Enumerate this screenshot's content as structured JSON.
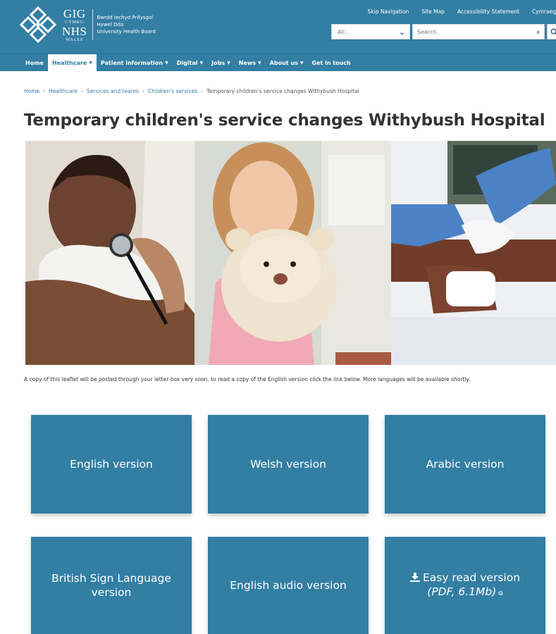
{
  "header": {
    "logo": {
      "line1": "GIG",
      "line2": "CYMRU",
      "line3": "NHS",
      "line4": "WALES"
    },
    "org_names": [
      "Bwrdd Iechyd Prifysgol",
      "Hywel Dda",
      "University Health Board"
    ],
    "utility_links": [
      "Skip Navigation",
      "Site Map",
      "Accessibility Statement",
      "Cymraeg"
    ],
    "search": {
      "scope_value": "All...",
      "placeholder": "Search",
      "clear_label": "x"
    }
  },
  "nav": {
    "items": [
      {
        "label": "Home",
        "has_menu": false
      },
      {
        "label": "Healthcare",
        "has_menu": true,
        "active": true
      },
      {
        "label": "Patient information",
        "has_menu": true
      },
      {
        "label": "Digital",
        "has_menu": true
      },
      {
        "label": "Jobs",
        "has_menu": true
      },
      {
        "label": "News",
        "has_menu": true
      },
      {
        "label": "About us",
        "has_menu": true
      },
      {
        "label": "Get in touch",
        "has_menu": false
      }
    ]
  },
  "breadcrumb": [
    "Home",
    "Healthcare",
    "Services and teams",
    "Children's services",
    "Temporary children's service changes Withybush Hospital"
  ],
  "page": {
    "title": "Temporary children's service changes Withybush Hospital",
    "intro": "A copy of this leaflet will be posted through your letter box very soon. to read a copy of the English version click the link below. More languages will be available shortly."
  },
  "tiles": [
    {
      "label": "English version"
    },
    {
      "label": "Welsh version"
    },
    {
      "label": "Arabic version"
    },
    {
      "label": "British Sign Language version"
    },
    {
      "label": "English audio version"
    },
    {
      "label": "Easy read version",
      "format": "(PDF, 6.1Mb)"
    }
  ],
  "icons": {
    "search_button": "search-icon",
    "download": "download-icon",
    "external": "external-link-icon",
    "dropdown": "chevron-down-icon"
  },
  "colors": {
    "brand": "#337ea3",
    "link": "#3a7aa3",
    "title": "#333333"
  }
}
